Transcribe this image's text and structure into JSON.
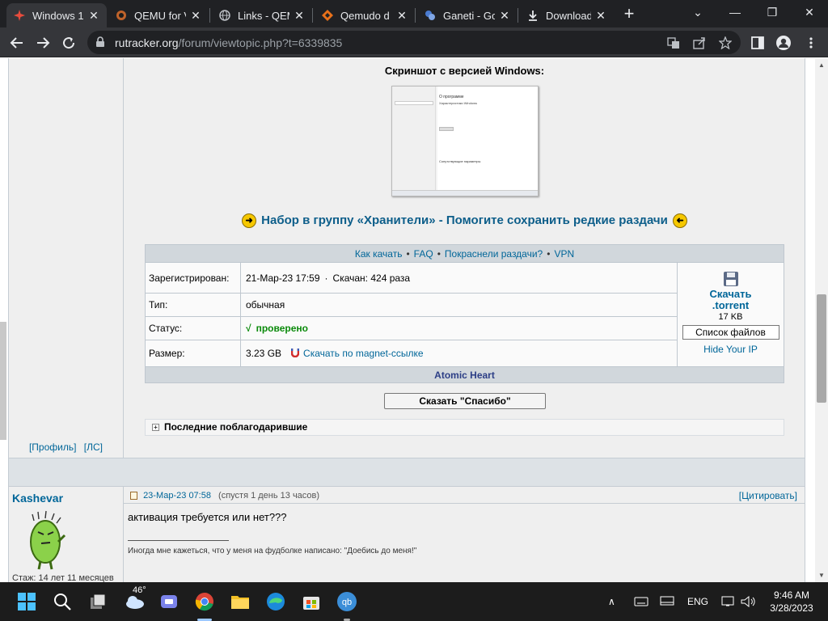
{
  "browser": {
    "tabs": [
      {
        "title": "Windows 1",
        "active": true,
        "icon": "rutracker-icon"
      },
      {
        "title": "QEMU for V",
        "active": false,
        "icon": "qemu-icon"
      },
      {
        "title": "Links - QEM",
        "active": false,
        "icon": "globe-icon"
      },
      {
        "title": "Qemudo d",
        "active": false,
        "icon": "qemudo-icon"
      },
      {
        "title": "Ganeti - Go",
        "active": false,
        "icon": "ganeti-icon"
      },
      {
        "title": "Downloads",
        "active": false,
        "icon": "download-icon"
      }
    ],
    "new_tab": "+",
    "url_host": "rutracker.org",
    "url_path": "/forum/viewtopic.php?t=6339835"
  },
  "post1": {
    "screenshot_caption": "Скриншот с версией Windows:",
    "thumb": {
      "heading": "О программе",
      "subheading": "Характеристики Windows",
      "related": "Сопутствующие параметры"
    },
    "keepers_banner": "Набор в группу «Хранители» - Помогите сохранить редкие раздачи",
    "links": [
      "Как качать",
      "FAQ",
      "Покраснели раздачи?",
      "VPN"
    ],
    "rows": {
      "registered_label": "Зарегистрирован:",
      "registered_value": "21-Мар-23 17:59",
      "downloaded_value": "Скачан: 424 раза",
      "type_label": "Тип:",
      "type_value": "обычная",
      "status_label": "Статус:",
      "status_check": "√",
      "status_value": "проверено",
      "size_label": "Размер:",
      "size_value": "3.23 GB",
      "magnet_value": "Скачать по magnet-ссылке"
    },
    "download": {
      "label1": "Скачать",
      "label2": ".torrent",
      "size": "17 KB",
      "file_list": "Список файлов",
      "hide_ip": "Hide Your IP"
    },
    "release_name": "Atomic Heart",
    "thanks_button": "Сказать \"Спасибо\"",
    "last_thanked": "Последние поблагодарившие",
    "profile_link": "[Профиль]",
    "pm_link": "[ЛС]"
  },
  "post2": {
    "username": "Kashevar",
    "date": "23-Мар-23 07:58",
    "since": "(спустя 1 день 13 часов)",
    "quote": "[Цитировать]",
    "text": "активация требуется или нет???",
    "signature": "Иногда мне кажеться, что у меня на фудболке написано: \"Доебись до меня!\"",
    "stazh": "Стаж: 14 лет 11 месяцев"
  },
  "taskbar": {
    "weather": "46°",
    "lang": "ENG",
    "time": "9:46 AM",
    "date": "3/28/2023"
  },
  "colors": {
    "link": "#006699",
    "post_bg": "#efefef",
    "header_bg": "#d1d7dc",
    "status_ok": "#0a8a0a"
  }
}
